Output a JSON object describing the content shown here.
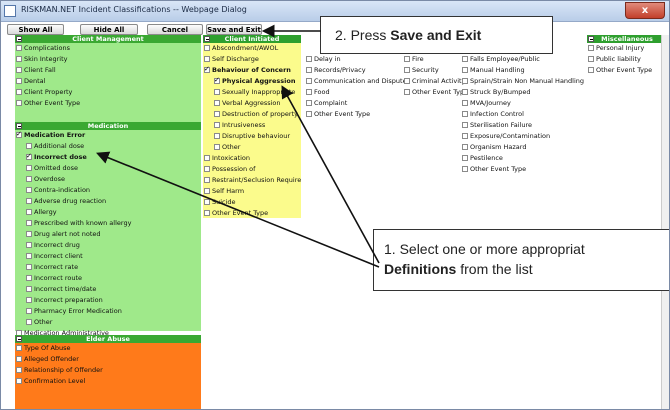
{
  "window": {
    "title": "RISKMAN.NET Incident Classifications -- Webpage Dialog",
    "close": "x"
  },
  "toolbar": {
    "show_all": "Show All",
    "hide_all": "Hide All",
    "cancel": "Cancel",
    "save_exit": "Save and Exit"
  },
  "client_management": {
    "header": "Client Management",
    "items": [
      "Complications",
      "Skin Integrity",
      "Client Fall",
      "Dental",
      "Client Property",
      "Other Event Type"
    ]
  },
  "medication": {
    "header": "Medication",
    "parent": "Medication Error",
    "subitems": [
      "Additional dose",
      "Incorrect dose",
      "Omitted dose",
      "Overdose",
      "Contra-indication",
      "Adverse drug reaction",
      "Allergy",
      "Prescribed with known allergy",
      "Drug alert not noted",
      "Incorrect drug",
      "Incorrect client",
      "Incorrect rate",
      "Incorrect route",
      "Incorrect time/date",
      "Incorrect preparation",
      "Pharmacy Error Medication",
      "Other"
    ],
    "items": [
      "Medication Administrative",
      "Medication Administration"
    ]
  },
  "elder_abuse": {
    "header": "Elder Abuse",
    "items": [
      "Type Of Abuse",
      "Alleged Offender",
      "Relationship of Offender",
      "Confirmation Level"
    ]
  },
  "client_initiated": {
    "header": "Client Initiated",
    "items_top": [
      "Abscondment/AWOL",
      "Self Discharge"
    ],
    "parent": "Behaviour of Concern",
    "subitems": [
      "Physical Aggression",
      "Sexually Inappropriate",
      "Verbal Aggression",
      "Destruction of property",
      "Intrusiveness",
      "Disruptive behaviour",
      "Other"
    ],
    "items_bottom": [
      "Intoxication",
      "Possession of",
      "Restraint/Seclusion Required",
      "Self Harm",
      "Suicide",
      "Other Event Type"
    ]
  },
  "col_general": {
    "items": [
      "Delay in",
      "Records/Privacy",
      "Communication and Disputes",
      "Food",
      "Complaint",
      "Other Event Type"
    ]
  },
  "col_facilities": {
    "items": [
      "Fire",
      "Security",
      "Criminal Activity",
      "Other Event Type"
    ]
  },
  "col_staff": {
    "items": [
      "Falls Employee/Public",
      "Manual Handling",
      "Sprain/Strain Non Manual Handling",
      "Struck By/Bumped",
      "MVA/Journey",
      "Infection Control",
      "Sterilisation Failure",
      "Exposure/Contamination",
      "Organism Hazard",
      "Pestilence",
      "Other Event Type"
    ]
  },
  "miscellaneous": {
    "header": "Miscellaneous",
    "items": [
      "Personal Injury",
      "Public liability",
      "Other Event Type"
    ]
  },
  "callouts": {
    "step2_prefix": "2. Press ",
    "step2_bold": "Save and Exit",
    "step1_line1": "1. Select one or more appropriat",
    "step1_bold": "Definitions",
    "step1_suffix": " from the list"
  }
}
